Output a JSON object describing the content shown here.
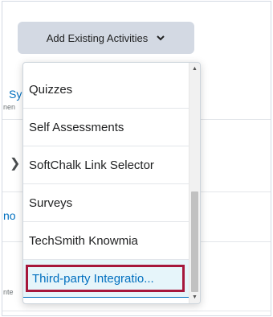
{
  "toolbar": {
    "add_existing_label": "Add Existing Activities"
  },
  "background": {
    "frag1": "Sy",
    "frag1_sub": "nen",
    "frag2": "no",
    "frag3": "nte"
  },
  "menu": {
    "items": [
      {
        "label": "Quizzes"
      },
      {
        "label": "Self Assessments"
      },
      {
        "label": "SoftChalk Link Selector"
      },
      {
        "label": "Surveys"
      },
      {
        "label": "TechSmith Knowmia"
      },
      {
        "label": "Third-party Integratio..."
      }
    ]
  },
  "colors": {
    "accent": "#006fbf",
    "highlight_border": "#a6173b",
    "button_bg": "#d3d9e3"
  }
}
